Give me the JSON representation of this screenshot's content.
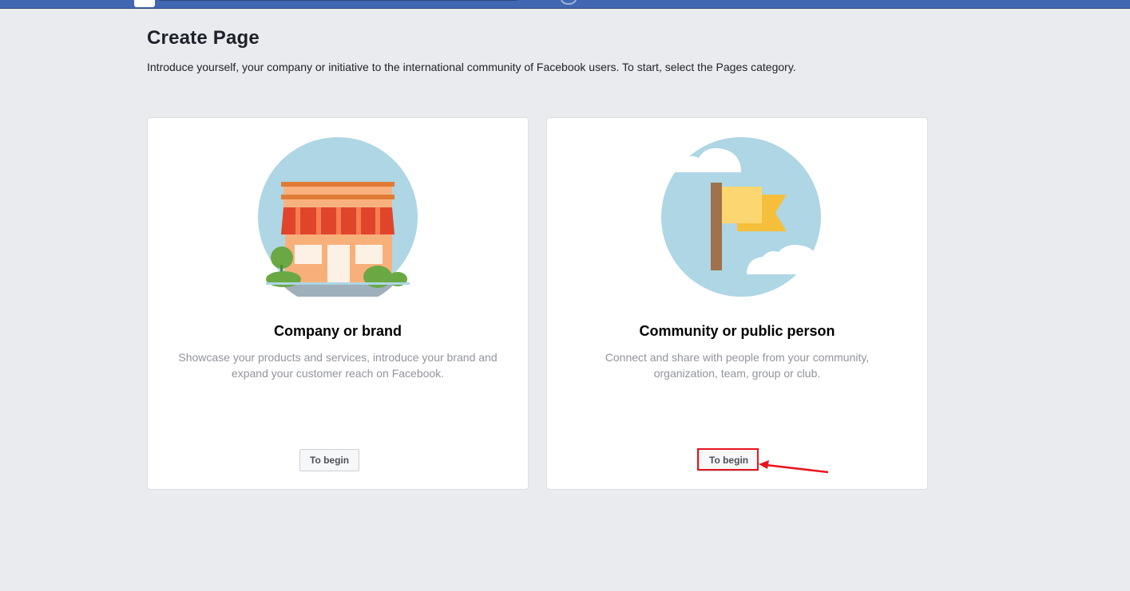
{
  "header": {
    "title": "Create Page",
    "intro": "Introduce yourself, your company or initiative to the international community of Facebook users. To start, select the Pages category."
  },
  "cards": [
    {
      "title": "Company or brand",
      "description": "Showcase your products and services, introduce your brand and expand your customer reach on Facebook.",
      "button_label": "To begin",
      "illustration": "storefront-illustration"
    },
    {
      "title": "Community or public person",
      "description": "Connect and share with people from your community, organization, team, group or club.",
      "button_label": "To begin",
      "illustration": "flag-illustration"
    }
  ],
  "annotation": {
    "color": "#e8141a",
    "target": "community-begin-button"
  },
  "colors": {
    "topbar": "#4267b2",
    "background": "#e9ebee",
    "circle": "#aed6e4"
  }
}
